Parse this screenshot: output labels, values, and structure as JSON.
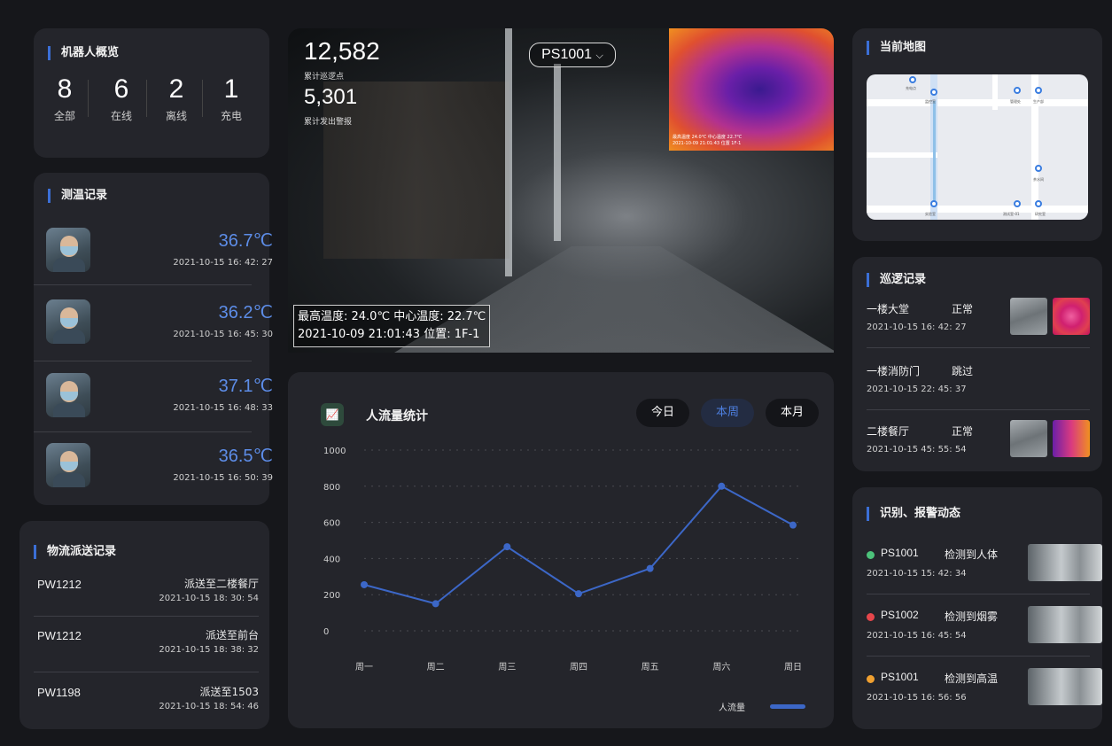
{
  "robot_overview": {
    "title": "机器人概览",
    "stats": [
      {
        "value": "8",
        "label": "全部"
      },
      {
        "value": "6",
        "label": "在线"
      },
      {
        "value": "2",
        "label": "离线"
      },
      {
        "value": "1",
        "label": "充电"
      }
    ]
  },
  "temp_records": {
    "title": "测温记录",
    "items": [
      {
        "temp": "36.7℃",
        "time": "2021-10-15 16: 42: 27"
      },
      {
        "temp": "36.2℃",
        "time": "2021-10-15 16: 45: 30"
      },
      {
        "temp": "37.1℃",
        "time": "2021-10-15 16: 48: 33"
      },
      {
        "temp": "36.5℃",
        "time": "2021-10-15 16: 50: 39"
      }
    ]
  },
  "logistics": {
    "title": "物流派送记录",
    "items": [
      {
        "code": "PW1212",
        "dest": "派送至二楼餐厅",
        "time": "2021-10-15 18: 30: 54"
      },
      {
        "code": "PW1212",
        "dest": "派送至前台",
        "time": "2021-10-15 18: 38: 32"
      },
      {
        "code": "PW1198",
        "dest": "派送至1503",
        "time": "2021-10-15 18: 54: 46"
      }
    ]
  },
  "camera": {
    "patrol_points": "12,582",
    "patrol_points_label": "累计巡逻点",
    "alarms": "5,301",
    "alarms_label": "累计发出警报",
    "robot_select": "PS1001",
    "thermal_caption_1": "最高温度  24.0℃   中心温度  22.7℃",
    "thermal_caption_2": "2021-10-09 21:01:43   位置  1F-1",
    "info_line1": "最高温度: 24.0℃  中心温度: 22.7℃",
    "info_line2": "2021-10-09 21:01:43  位置: 1F-1"
  },
  "traffic": {
    "title": "人流量统计",
    "tabs": [
      "今日",
      "本周",
      "本月"
    ],
    "active_tab": "本周",
    "legend": "人流量"
  },
  "chart_data": {
    "type": "line",
    "categories": [
      "周一",
      "周二",
      "周三",
      "周四",
      "周五",
      "周六",
      "周日"
    ],
    "series": [
      {
        "name": "人流量",
        "values": [
          255,
          150,
          465,
          205,
          345,
          800,
          585
        ]
      }
    ],
    "yticks": [
      1000,
      800,
      600,
      400,
      200,
      0
    ],
    "ylim": [
      0,
      1000
    ],
    "grid": true,
    "legend_position": "bottom-right",
    "color": "#3c67c7"
  },
  "map": {
    "title": "当前地图",
    "labels": [
      "充电点",
      "监控室",
      "管理处",
      "生产部",
      "茶水间",
      "实验室",
      "测试室-01",
      "研究室"
    ]
  },
  "patrol": {
    "title": "巡逻记录",
    "items": [
      {
        "place": "一楼大堂",
        "status": "正常",
        "time": "2021-10-15 16: 42: 27"
      },
      {
        "place": "一楼消防门",
        "status": "跳过",
        "time": "2021-10-15 22: 45: 37"
      },
      {
        "place": "二楼餐厅",
        "status": "正常",
        "time": "2021-10-15 45: 55: 54"
      }
    ]
  },
  "alarms": {
    "title": "识别、报警动态",
    "items": [
      {
        "code": "PS1001",
        "msg": "检测到人体",
        "time": "2021-10-15 15: 42: 34",
        "color": "#4cc27a"
      },
      {
        "code": "PS1002",
        "msg": "检测到烟雾",
        "time": "2021-10-15 16: 45: 54",
        "color": "#e6464b"
      },
      {
        "code": "PS1001",
        "msg": "检测到高温",
        "time": "2021-10-15 16: 56: 56",
        "color": "#f0a030"
      }
    ]
  }
}
